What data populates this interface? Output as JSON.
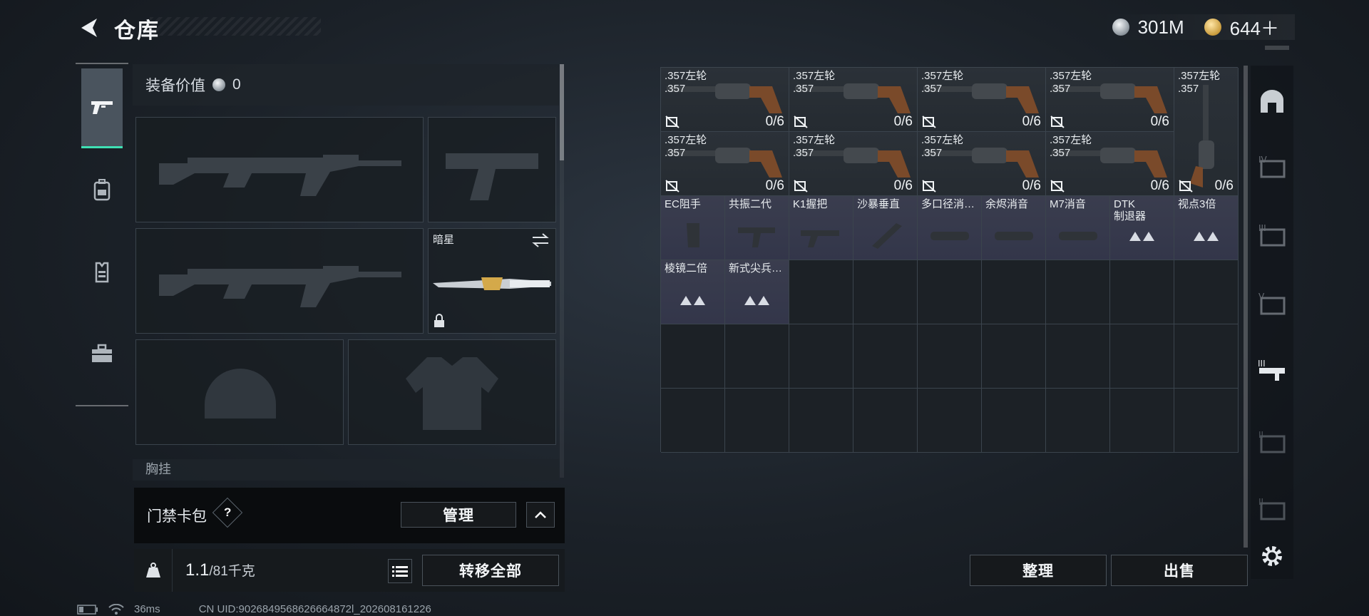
{
  "header": {
    "title": "仓库",
    "currencies": [
      {
        "icon": "silver-coin-icon",
        "value": "301M"
      },
      {
        "icon": "gold-coin-icon",
        "value": "644＋"
      }
    ]
  },
  "side_tabs": [
    "weapon-icon",
    "backpack-icon",
    "vest-icon",
    "toolbox-icon"
  ],
  "loadout": {
    "value_label": "装备价值",
    "value": "0",
    "melee_label": "暗星",
    "chest_label": "胸挂"
  },
  "keycard": {
    "label": "门禁卡包",
    "help": "?",
    "manage": "管理"
  },
  "weight": {
    "current": "1.1",
    "max": "/81千克",
    "transfer_all": "转移全部"
  },
  "stash": {
    "revolvers": [
      {
        "name": ".357左轮",
        "sub": ".357",
        "count": "0/6"
      },
      {
        "name": ".357左轮",
        "sub": ".357",
        "count": "0/6"
      },
      {
        "name": ".357左轮",
        "sub": ".357",
        "count": "0/6"
      },
      {
        "name": ".357左轮",
        "sub": ".357",
        "count": "0/6"
      },
      {
        "name": ".357左轮",
        "sub": ".357",
        "count": "0/6"
      },
      {
        "name": ".357左轮",
        "sub": ".357",
        "count": "0/6"
      },
      {
        "name": ".357左轮",
        "sub": ".357",
        "count": "0/6"
      },
      {
        "name": ".357左轮",
        "sub": ".357",
        "count": "0/6"
      },
      {
        "name": ".357左轮",
        "sub": ".357",
        "count": "0/6"
      }
    ],
    "attachments": [
      {
        "name": "EC阻手",
        "icon": "grip-icon"
      },
      {
        "name": "共振二代",
        "icon": "foregrip-icon"
      },
      {
        "name": "K1握把",
        "icon": "stock-icon"
      },
      {
        "name": "沙暴垂直",
        "icon": "vertical-grip-icon"
      },
      {
        "name": "多口径消…",
        "icon": "suppressor-icon"
      },
      {
        "name": "余烬消音",
        "icon": "suppressor-icon"
      },
      {
        "name": "M7消音",
        "icon": "suppressor-icon"
      },
      {
        "name": "DTK\n制退器",
        "icon": "placeholder-icon"
      },
      {
        "name": "视点3倍",
        "icon": "placeholder-icon"
      },
      {
        "name": "棱镜二倍",
        "icon": "placeholder-icon"
      },
      {
        "name": "新式尖兵…",
        "icon": "placeholder-icon"
      }
    ],
    "sort_button": "整理",
    "sell_button": "出售"
  },
  "status": {
    "ping": "36ms",
    "uid": "CN UID:9026849568626664872l_202608161226"
  },
  "colors": {
    "accent": "#3fe0b4",
    "attachment_bg": "#3a3d4e"
  }
}
